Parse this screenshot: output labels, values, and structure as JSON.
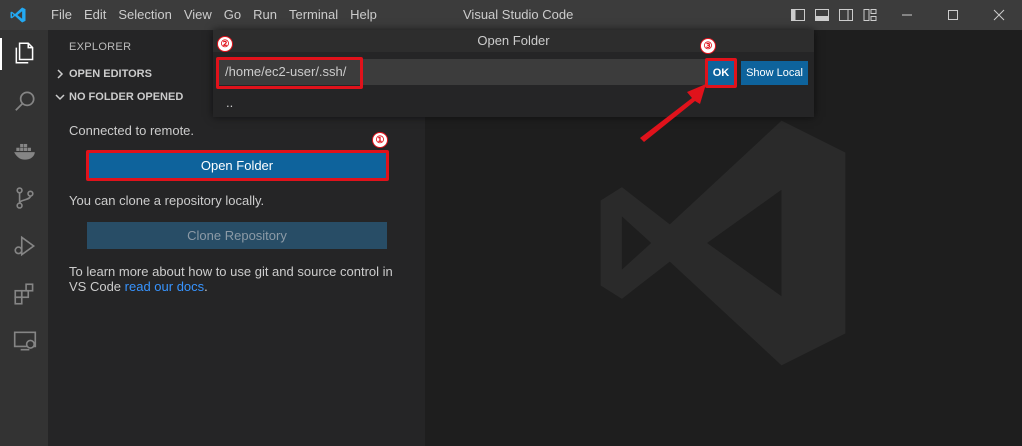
{
  "titlebar": {
    "menu": [
      "File",
      "Edit",
      "Selection",
      "View",
      "Go",
      "Run",
      "Terminal",
      "Help"
    ],
    "title": "Visual Studio Code"
  },
  "activity_bar": {
    "icons": [
      "explorer-icon",
      "search-icon",
      "docker-icon",
      "source-control-icon",
      "run-debug-icon",
      "extensions-icon",
      "remote-explorer-icon"
    ]
  },
  "sidebar": {
    "title": "EXPLORER",
    "open_editors": "OPEN EDITORS",
    "no_folder": "NO FOLDER OPENED",
    "connected": "Connected to remote.",
    "open_folder_button": "Open Folder",
    "clone_text": "You can clone a repository locally.",
    "clone_button": "Clone Repository",
    "learn_text_line1": "To learn more about how to use git and source control in",
    "learn_text_line2": "VS Code ",
    "learn_link": "read our docs",
    "learn_period": "."
  },
  "dialog": {
    "title": "Open Folder",
    "input_value": "/home/ec2-user/.ssh/",
    "ok_label": "OK",
    "show_local_label": "Show Local",
    "item": ".."
  },
  "annotations": {
    "badge1": "①",
    "badge2": "②",
    "badge3": "③",
    "highlight_color": "#e0121b"
  },
  "colors": {
    "accent": "#0e639c",
    "link": "#3794ff",
    "vscode_blue": "#23a9f2"
  }
}
